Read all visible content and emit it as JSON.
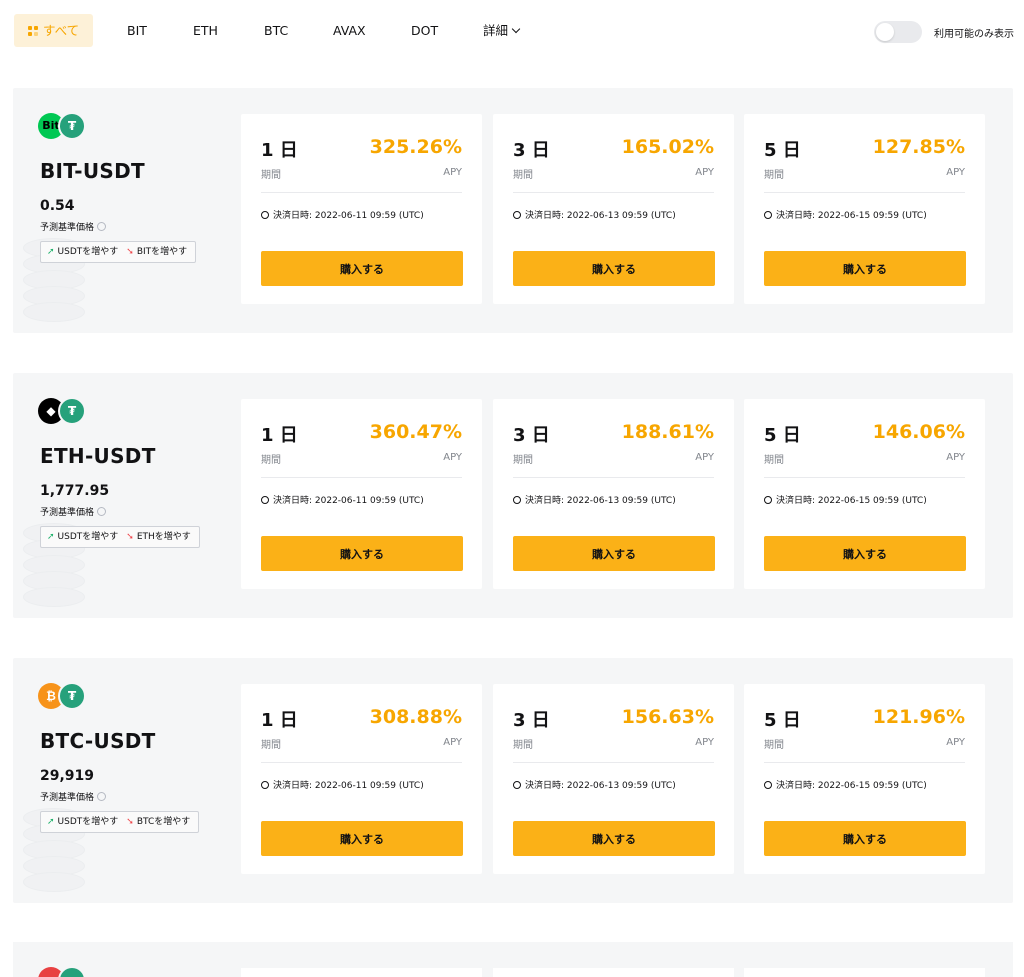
{
  "filters": {
    "tabs": [
      "すべて",
      "BIT",
      "ETH",
      "BTC",
      "AVAX",
      "DOT"
    ],
    "more_label": "詳細",
    "toggle_label": "利用可能のみ表示"
  },
  "colors": {
    "accent": "#f7a600",
    "button": "#fbb117",
    "up": "#20b26c",
    "down": "#ef454a"
  },
  "products": [
    {
      "pair": "BIT-USDT",
      "coin_icons": [
        "Bit",
        "₮"
      ],
      "price": "0.54",
      "price_label": "予測基準価格",
      "up_text": "USDTを増やす",
      "down_text": "BITを増やす",
      "terms": [
        {
          "term": "1 日",
          "term_label": "期間",
          "apy": "325.26%",
          "apy_label": "APY",
          "settle": "決済日時: 2022-06-11 09:59 (UTC)",
          "buy_label": "購入する"
        },
        {
          "term": "3 日",
          "term_label": "期間",
          "apy": "165.02%",
          "apy_label": "APY",
          "settle": "決済日時: 2022-06-13 09:59 (UTC)",
          "buy_label": "購入する"
        },
        {
          "term": "5 日",
          "term_label": "期間",
          "apy": "127.85%",
          "apy_label": "APY",
          "settle": "決済日時: 2022-06-15 09:59 (UTC)",
          "buy_label": "購入する"
        }
      ]
    },
    {
      "pair": "ETH-USDT",
      "coin_icons": [
        "◆",
        "₮"
      ],
      "price": "1,777.95",
      "price_label": "予測基準価格",
      "up_text": "USDTを増やす",
      "down_text": "ETHを増やす",
      "terms": [
        {
          "term": "1 日",
          "term_label": "期間",
          "apy": "360.47%",
          "apy_label": "APY",
          "settle": "決済日時: 2022-06-11 09:59 (UTC)",
          "buy_label": "購入する"
        },
        {
          "term": "3 日",
          "term_label": "期間",
          "apy": "188.61%",
          "apy_label": "APY",
          "settle": "決済日時: 2022-06-13 09:59 (UTC)",
          "buy_label": "購入する"
        },
        {
          "term": "5 日",
          "term_label": "期間",
          "apy": "146.06%",
          "apy_label": "APY",
          "settle": "決済日時: 2022-06-15 09:59 (UTC)",
          "buy_label": "購入する"
        }
      ]
    },
    {
      "pair": "BTC-USDT",
      "coin_icons": [
        "₿",
        "₮"
      ],
      "price": "29,919",
      "price_label": "予測基準価格",
      "up_text": "USDTを増やす",
      "down_text": "BTCを増やす",
      "terms": [
        {
          "term": "1 日",
          "term_label": "期間",
          "apy": "308.88%",
          "apy_label": "APY",
          "settle": "決済日時: 2022-06-11 09:59 (UTC)",
          "buy_label": "購入する"
        },
        {
          "term": "3 日",
          "term_label": "期間",
          "apy": "156.63%",
          "apy_label": "APY",
          "settle": "決済日時: 2022-06-13 09:59 (UTC)",
          "buy_label": "購入する"
        },
        {
          "term": "5 日",
          "term_label": "期間",
          "apy": "121.96%",
          "apy_label": "APY",
          "settle": "決済日時: 2022-06-15 09:59 (UTC)",
          "buy_label": "購入する"
        }
      ]
    }
  ]
}
